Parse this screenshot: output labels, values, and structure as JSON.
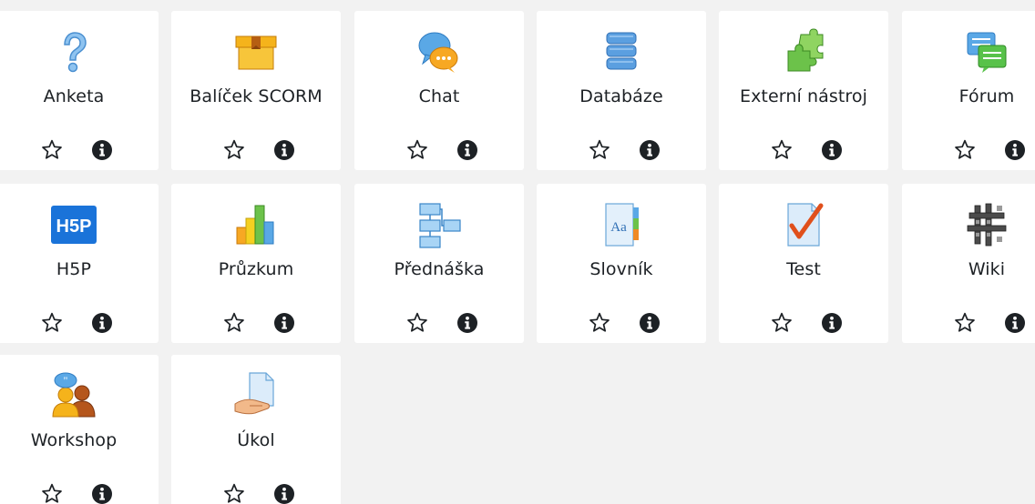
{
  "activities": [
    {
      "name": "Anketa",
      "icon": "question-mark-icon"
    },
    {
      "name": "Balíček SCORM",
      "icon": "scorm-package-icon"
    },
    {
      "name": "Chat",
      "icon": "chat-bubbles-icon"
    },
    {
      "name": "Databáze",
      "icon": "database-icon"
    },
    {
      "name": "Externí nástroj",
      "icon": "puzzle-icon"
    },
    {
      "name": "Fórum",
      "icon": "forum-icon"
    },
    {
      "name": "H5P",
      "icon": "h5p-icon"
    },
    {
      "name": "Průzkum",
      "icon": "bar-chart-icon"
    },
    {
      "name": "Přednáška",
      "icon": "lesson-flow-icon"
    },
    {
      "name": "Slovník",
      "icon": "glossary-icon"
    },
    {
      "name": "Test",
      "icon": "quiz-checkmark-icon"
    },
    {
      "name": "Wiki",
      "icon": "wiki-icon"
    },
    {
      "name": "Workshop",
      "icon": "workshop-people-icon"
    },
    {
      "name": "Úkol",
      "icon": "assignment-icon"
    }
  ],
  "actions": {
    "star_icon": "star-outline-icon",
    "info_icon": "info-circle-icon"
  },
  "colors": {
    "background": "#f2f2f2",
    "card": "#ffffff",
    "text": "#1d2125"
  }
}
